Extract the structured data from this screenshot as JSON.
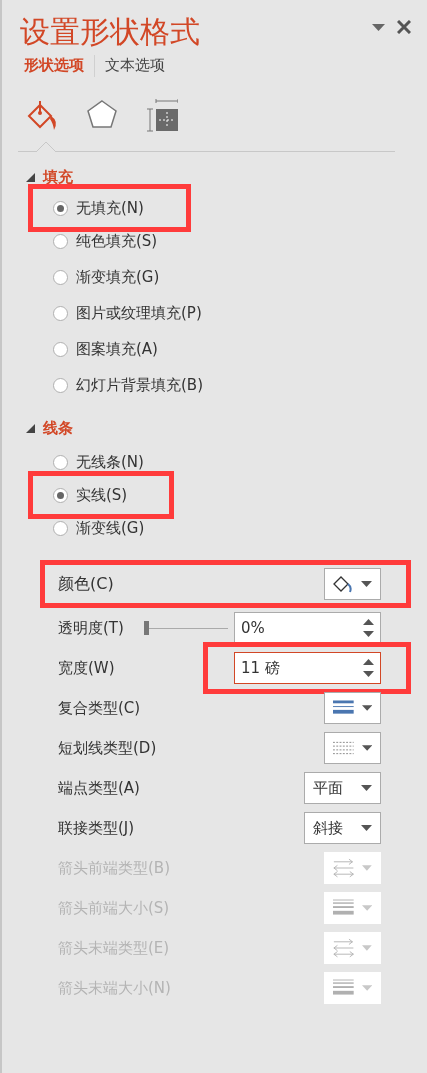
{
  "panel": {
    "title": "设置形状格式"
  },
  "tabs": [
    {
      "label": "形状选项",
      "selected": true
    },
    {
      "label": "文本选项",
      "selected": false
    }
  ],
  "category_tabs": [
    {
      "kind": "fill",
      "selected": true
    },
    {
      "kind": "effects",
      "selected": false
    },
    {
      "kind": "size",
      "selected": false
    }
  ],
  "sections": [
    {
      "title": "填充",
      "expanded": true,
      "options": [
        {
          "label": "无填充(N)",
          "selected": true,
          "highlighted": true
        },
        {
          "label": "纯色填充(S)",
          "selected": false,
          "highlighted": false
        },
        {
          "label": "渐变填充(G)",
          "selected": false,
          "highlighted": false
        },
        {
          "label": "图片或纹理填充(P)",
          "selected": false,
          "highlighted": false
        },
        {
          "label": "图案填充(A)",
          "selected": false,
          "highlighted": false
        },
        {
          "label": "幻灯片背景填充(B)",
          "selected": false,
          "highlighted": false
        }
      ]
    },
    {
      "title": "线条",
      "expanded": true,
      "options": [
        {
          "label": "无线条(N)",
          "selected": false,
          "highlighted": false
        },
        {
          "label": "实线(S)",
          "selected": true,
          "highlighted": true
        },
        {
          "label": "渐变线(G)",
          "selected": false,
          "highlighted": false
        }
      ],
      "rows": [
        {
          "kind": "color",
          "label": "颜色(C)",
          "highlighted": true,
          "disabled": false
        },
        {
          "kind": "slider",
          "label": "透明度(T)",
          "level": 0,
          "value": "0%",
          "highlighted": false,
          "disabled": false
        },
        {
          "kind": "spin",
          "label": "宽度(W)",
          "value": "11 磅",
          "focused": true,
          "highlighted": true,
          "disabled": false
        },
        {
          "kind": "compound",
          "label": "复合类型(C)",
          "highlighted": false,
          "disabled": false
        },
        {
          "kind": "dash",
          "label": "短划线类型(D)",
          "highlighted": false,
          "disabled": false
        },
        {
          "kind": "dropdown",
          "label": "端点类型(A)",
          "value": "平面",
          "highlighted": false,
          "disabled": false
        },
        {
          "kind": "dropdown",
          "label": "联接类型(J)",
          "value": "斜接",
          "highlighted": false,
          "disabled": false
        },
        {
          "kind": "arrow",
          "label": "箭头前端类型(B)",
          "highlighted": false,
          "disabled": true
        },
        {
          "kind": "weight",
          "label": "箭头前端大小(S)",
          "highlighted": false,
          "disabled": true
        },
        {
          "kind": "arrow",
          "label": "箭头末端类型(E)",
          "highlighted": false,
          "disabled": true
        },
        {
          "kind": "weight",
          "label": "箭头末端大小(N)",
          "highlighted": false,
          "disabled": true
        }
      ]
    }
  ]
}
